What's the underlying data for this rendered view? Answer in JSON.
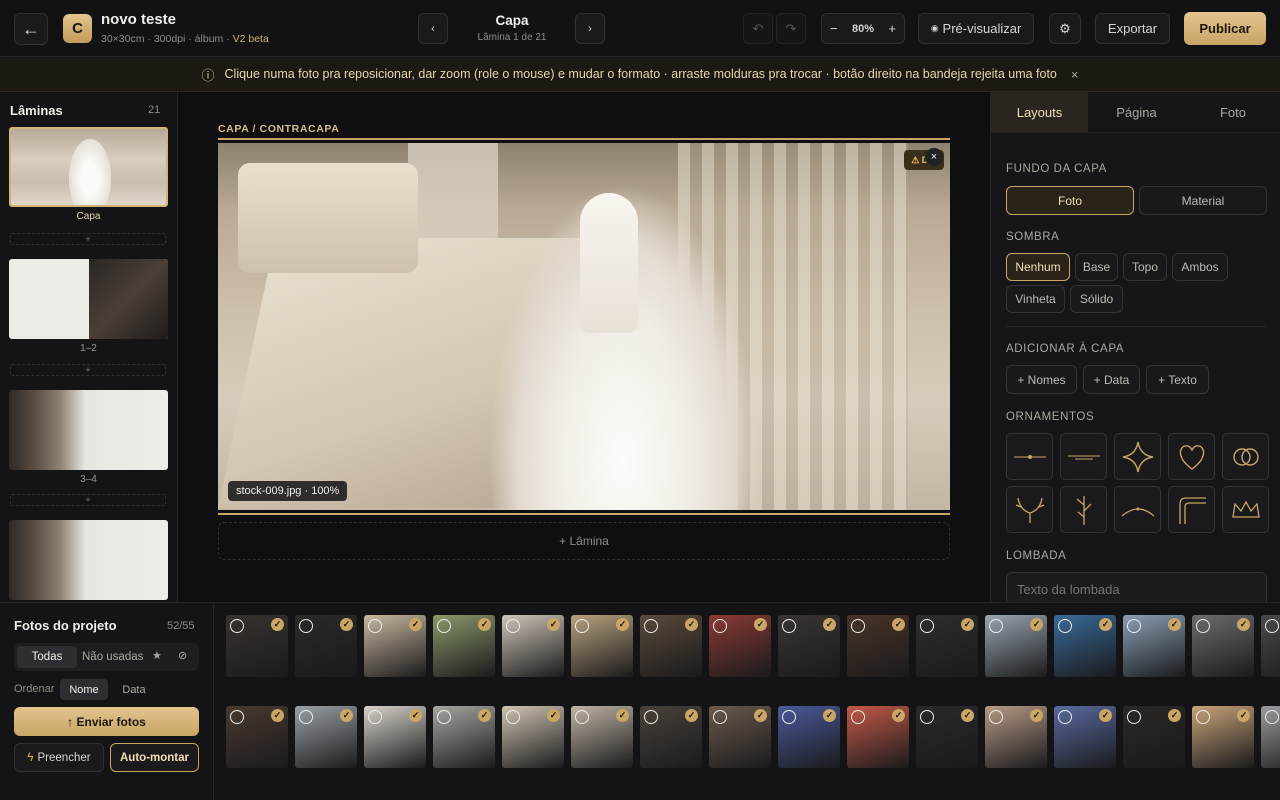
{
  "header": {
    "logo_letter": "C",
    "project_name": "novo teste",
    "project_meta": "30×30cm · 300dpi · álbum · ",
    "beta": "V2 beta",
    "page_title": "Capa",
    "page_sub": "Lâmina 1 de 21",
    "zoom": "80%",
    "preview": "Pré-visualizar",
    "export": "Exportar",
    "publish": "Publicar"
  },
  "banner": {
    "text": "Clique numa foto pra reposicionar, dar zoom (role o mouse) e mudar o formato · arraste molduras pra trocar · botão direito na bandeja rejeita uma foto"
  },
  "sidebar": {
    "title": "Lâminas",
    "count": "21",
    "add": "+",
    "items": [
      {
        "label": "Capa"
      },
      {
        "label": "1–2"
      },
      {
        "label": "3–4"
      }
    ]
  },
  "canvas": {
    "section_label": "CAPA / CONTRACAPA",
    "dpi_badge": "⚠ DPI",
    "close": "×",
    "photo_caption": "stock-009.jpg · 100%",
    "add_sheet": "+ Lâmina"
  },
  "right": {
    "tabs": [
      "Layouts",
      "Página",
      "Foto"
    ],
    "fundo": {
      "title": "FUNDO DA CAPA",
      "options": [
        "Foto",
        "Material"
      ]
    },
    "sombra": {
      "title": "SOMBRA",
      "options": [
        "Nenhum",
        "Base",
        "Topo",
        "Ambos",
        "Vinheta",
        "Sólido"
      ]
    },
    "adicionar": {
      "title": "ADICIONAR À CAPA",
      "options": [
        "+ Nomes",
        "+ Data",
        "+ Texto"
      ]
    },
    "ornamentos": {
      "title": "ORNAMENTOS"
    },
    "lombada": {
      "title": "LOMBADA",
      "placeholder": "Texto da lombada"
    }
  },
  "bottom": {
    "title": "Fotos do projeto",
    "count": "52/55",
    "filters": [
      "Todas",
      "Não usadas"
    ],
    "order_label": "Ordenar",
    "order_options": [
      "Nome",
      "Data"
    ],
    "upload": "↑ Enviar fotos",
    "fill": "Preencher",
    "auto": "Auto-montar"
  },
  "colors": {
    "accent": "#c9a566",
    "bg": "#141416"
  }
}
